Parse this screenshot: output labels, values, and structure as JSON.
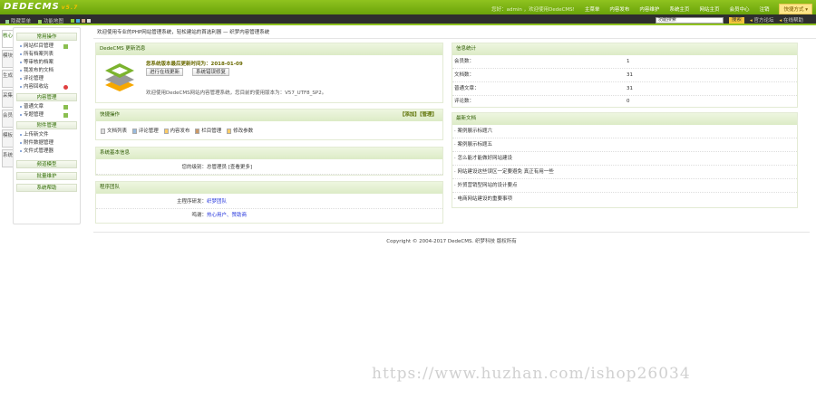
{
  "header": {
    "logo": "DEDECMS",
    "version": "v5.7",
    "greeting": "您好：admin ，欢迎使用DedeCMS!",
    "nav": [
      "主菜单",
      "内容发布",
      "内容维护",
      "系统主页",
      "网站主页",
      "会员中心",
      "注销"
    ],
    "quick": "快捷方式 ▾"
  },
  "toolbar": {
    "hide_menu": "隐藏菜单",
    "func_map": "功能地图",
    "search_value": "功能搜索",
    "search_btn": "搜索",
    "forum": "官方论坛",
    "help": "在线帮助"
  },
  "tabs": [
    "核心",
    "模块",
    "生成",
    "采集",
    "会员",
    "模板",
    "系统"
  ],
  "sidebar": {
    "groups": [
      {
        "title": "常用操作",
        "items": [
          "网站栏目管理",
          "所有档案列表",
          "等审核的档案",
          "我发布的文档",
          "评论管理",
          "内容回收站"
        ]
      },
      {
        "title": "内容管理",
        "items": [
          "普通文章",
          "专题管理"
        ]
      },
      {
        "title": "附件管理",
        "items": [
          "上传新文件",
          "附件数据管理",
          "文件式管理器"
        ]
      },
      {
        "title": "频道模型",
        "items": []
      },
      {
        "title": "批量维护",
        "items": []
      },
      {
        "title": "系统帮助",
        "items": []
      }
    ]
  },
  "main": {
    "welcome": "欢迎使用专业的PHP网站管理系统，轻松建站的首选利器 — 织梦内容管理系统",
    "update": {
      "title": "DedeCMS 更新消息",
      "date_label": "您系统版本最后更新时间为：2018-01-09",
      "btn_update": "进行在线更新",
      "btn_settings": "系统错误修复",
      "info": "欢迎使用DedeCMS网站内容管理系统，您目前的使用版本为：V57_UTF8_SP2。"
    },
    "quick": {
      "title": "快捷操作",
      "links": "【添加】【管理】",
      "items": [
        "文档列表",
        "评论管理",
        "内容发布",
        "栏目管理",
        "修改参数"
      ]
    },
    "sysinfo": {
      "title": "系统基本信息",
      "label": "您的级别：",
      "value": "总管理员 [查看更多]"
    },
    "team": {
      "title": "程序团队",
      "rows": [
        {
          "label": "主程序研发：",
          "value": "织梦团队"
        },
        {
          "label": "鸣谢：",
          "value": "热心用户、赞助商"
        }
      ]
    },
    "stats": {
      "title": "信息统计",
      "rows": [
        {
          "label": "会员数：",
          "value": "1"
        },
        {
          "label": "文档数：",
          "value": "31"
        },
        {
          "label": "普通文章：",
          "value": "31"
        },
        {
          "label": "评论数：",
          "value": "0"
        }
      ]
    },
    "latest": {
      "title": "最新文档",
      "items": [
        "· 案例展示标题六",
        "· 案例展示标题五",
        "· 怎么能才能做好网站建设",
        "· 网站建设这些误区一定要避免 真正有用一些",
        "· 外贸营销型网站的设计要点",
        "· 电商网站建设的重要事项"
      ]
    }
  },
  "footer": "Copyright © 2004-2017 DedeCMS. 织梦科技 版权所有",
  "watermark": "https://www.huzhan.com/ishop26034"
}
